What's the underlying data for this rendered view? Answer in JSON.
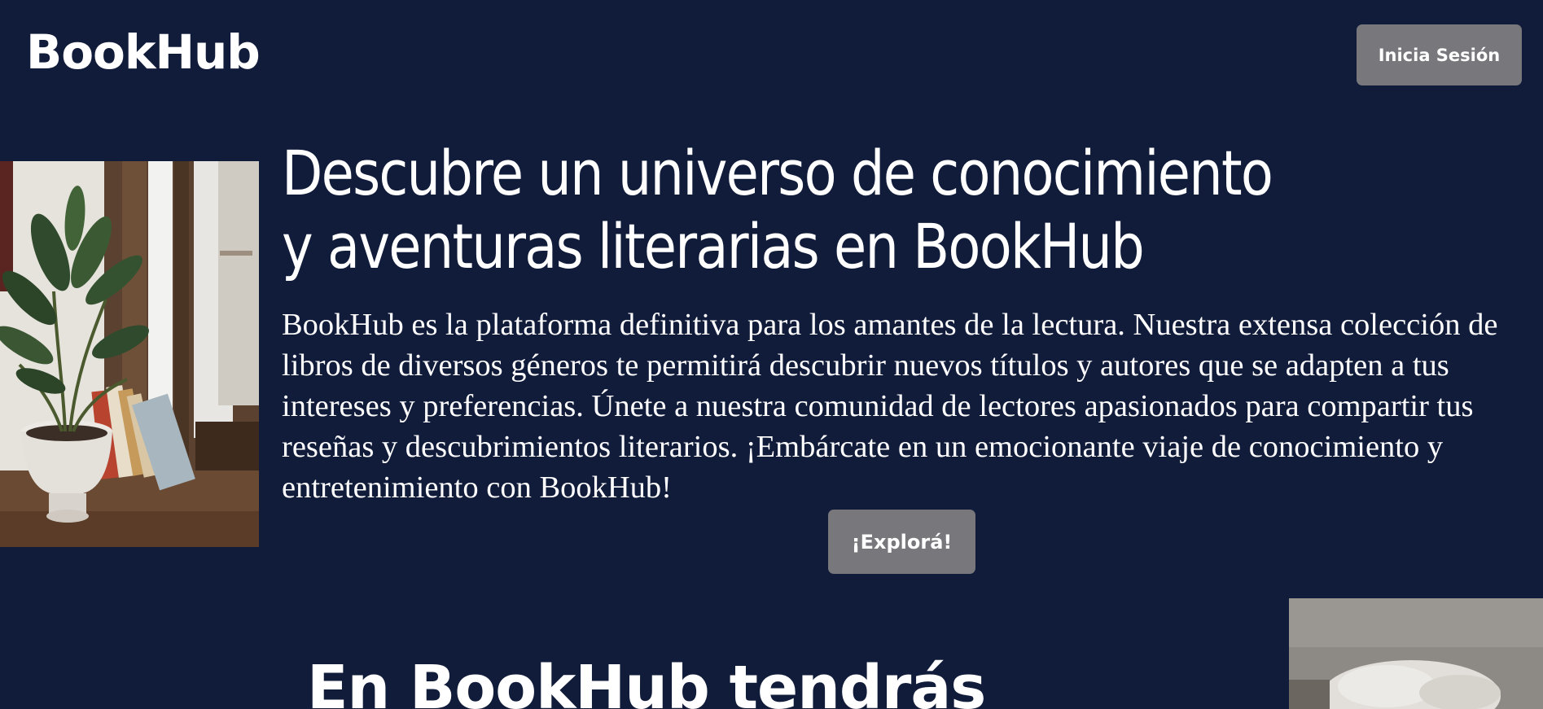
{
  "header": {
    "logo": "BookHub",
    "login_label": "Inicia Sesión"
  },
  "hero": {
    "title": "Descubre un universo de conocimiento y aventuras literarias en BookHub",
    "description": "BookHub es la plataforma definitiva para los amantes de la lectura. Nuestra extensa colección de libros de diversos géneros te permitirá descubrir nuevos títulos y autores que se adapten a tus intereses y preferencias. Únete a nuestra comunidad de lectores apasionados para compartir tus reseñas y descubrimientos literarios. ¡Embárcate en un emocionante viaje de conocimiento y entretenimiento con BookHub!",
    "cta_label": "¡Explorá!"
  },
  "features": {
    "heading": "En BookHub tendrás"
  },
  "colors": {
    "background": "#111b3a",
    "button": "#77777c",
    "text": "#ffffff"
  }
}
